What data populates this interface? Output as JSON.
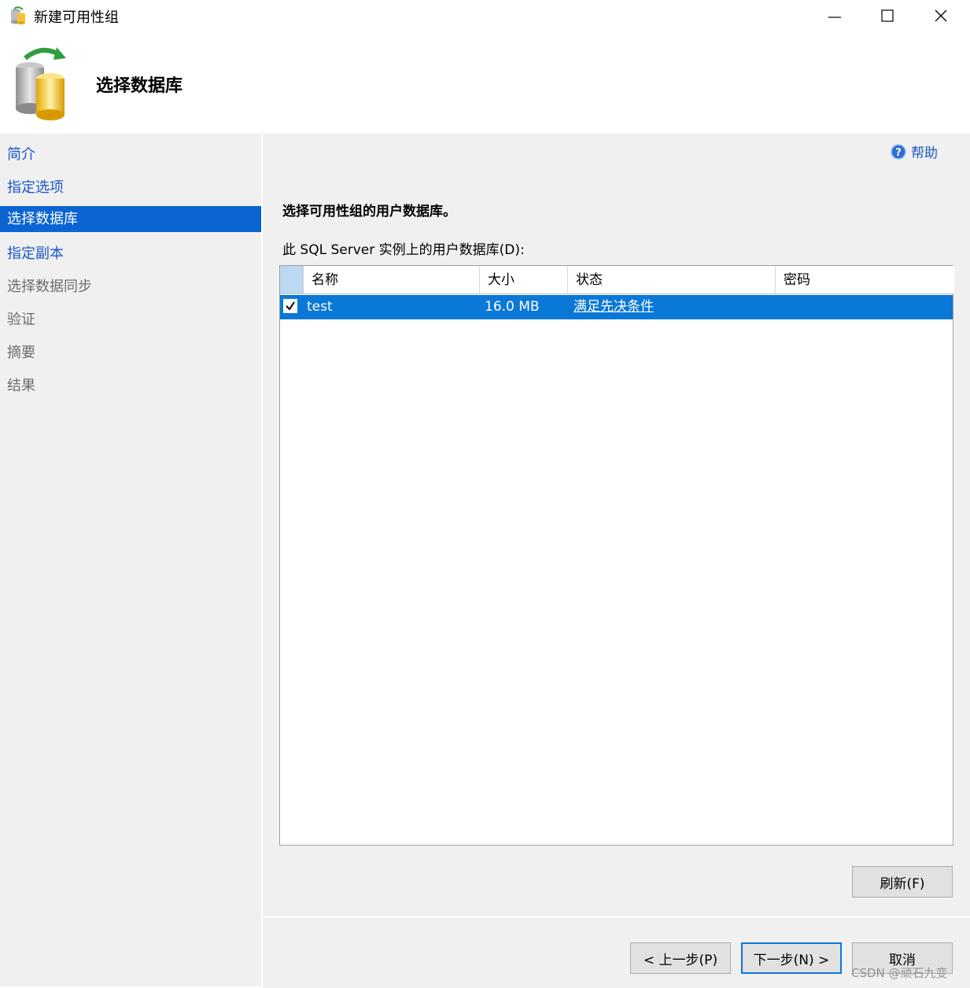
{
  "window": {
    "title": "新建可用性组",
    "controls": [
      "minimize",
      "maximize",
      "close"
    ]
  },
  "header": {
    "title": "选择数据库"
  },
  "nav": {
    "items": [
      {
        "label": "简介",
        "state": "link"
      },
      {
        "label": "指定选项",
        "state": "link"
      },
      {
        "label": "选择数据库",
        "state": "active"
      },
      {
        "label": "指定副本",
        "state": "link"
      },
      {
        "label": "选择数据同步",
        "state": "disabled"
      },
      {
        "label": "验证",
        "state": "disabled"
      },
      {
        "label": "摘要",
        "state": "disabled"
      },
      {
        "label": "结果",
        "state": "disabled"
      }
    ]
  },
  "main": {
    "help_label": "帮助",
    "instruction": "选择可用性组的用户数据库。",
    "list_label": "此 SQL Server 实例上的用户数据库(D):",
    "grid": {
      "columns": [
        "名称",
        "大小",
        "状态",
        "密码"
      ],
      "rows": [
        {
          "checked": true,
          "name": "test",
          "size": "16.0 MB",
          "status": "满足先决条件",
          "password": ""
        }
      ]
    },
    "refresh_label": "刷新(F)"
  },
  "footer": {
    "prev_label": "< 上一步(P)",
    "next_label": "下一步(N) >",
    "cancel_label": "取消"
  },
  "watermark": "CSDN @顽石九变",
  "colors": {
    "accent": "#0a64d2",
    "selection": "#0a78d7",
    "link": "#1a56c8",
    "panel": "#f0f0f0"
  }
}
